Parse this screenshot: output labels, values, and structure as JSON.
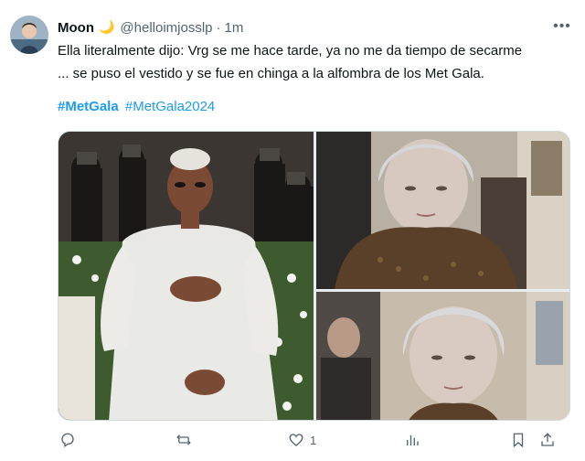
{
  "user": {
    "name": "Moon",
    "emoji": "🌙",
    "handle": "@helloimjosslp",
    "separator": "·",
    "time": "1m"
  },
  "tweet": {
    "lines": [
      "Ella literalmente dijo: Vrg se me hace tarde, ya no me da tiempo de secarme",
      "... se puso el vestido y se fue en chinga a la alfombra de los Met Gala."
    ],
    "hashtags": [
      "#MetGala",
      "#MetGala2024"
    ]
  },
  "media": {
    "images": [
      {
        "description_icon": "photo-icon"
      },
      {
        "description_icon": "photo-icon"
      },
      {
        "description_icon": "photo-icon"
      }
    ]
  },
  "actions": {
    "reply_count": "",
    "retweet_count": "",
    "like_count": "1",
    "views_count": ""
  },
  "colors": {
    "link": "#1d9bf0",
    "secondary_text": "#536471",
    "primary_text": "#0f1419"
  }
}
